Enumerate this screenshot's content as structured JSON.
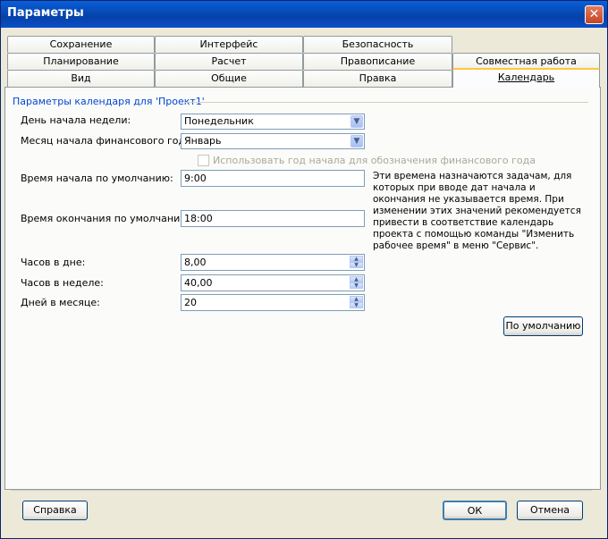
{
  "window": {
    "title": "Параметры",
    "close_symbol": "✕"
  },
  "tabs": {
    "row1": [
      "Сохранение",
      "Интерфейс",
      "Безопасность"
    ],
    "row2": [
      "Планирование",
      "Расчет",
      "Правописание",
      "Совместная работа"
    ],
    "row3": [
      "Вид",
      "Общие",
      "Правка",
      "Календарь"
    ],
    "active": "Календарь"
  },
  "calendar": {
    "group_title": "Параметры календаря для 'Проект1'",
    "week_start_label": "День начала недели:",
    "week_start_value": "Понедельник",
    "fiscal_month_label": "Месяц начала финансового года:",
    "fiscal_month_value": "Январь",
    "fiscal_year_checkbox_label": "Использовать год начала для обозначения финансового года",
    "fiscal_year_checked": false,
    "default_start_label": "Время начала по умолчанию:",
    "default_start_value": "9:00",
    "default_end_label": "Время окончания по умолчанию:",
    "default_end_value": "18:00",
    "note": "Эти времена назначаются задачам, для которых при вводе дат начала и окончания не указывается время. При изменении этих значений рекомендуется привести в соответствие календарь проекта с помощью команды \"Изменить рабочее время\" в меню \"Сервис\".",
    "hours_day_label": "Часов в дне:",
    "hours_day_value": "8,00",
    "hours_week_label": "Часов в неделе:",
    "hours_week_value": "40,00",
    "days_month_label": "Дней в месяце:",
    "days_month_value": "20",
    "default_button": "По умолчанию"
  },
  "footer": {
    "help_button": "Справка",
    "ok_button": "ОК",
    "cancel_button": "Отмена"
  },
  "icons": {
    "dropdown": "chevron-down-icon",
    "spin_up": "spin-up-icon",
    "spin_down": "spin-down-icon"
  }
}
